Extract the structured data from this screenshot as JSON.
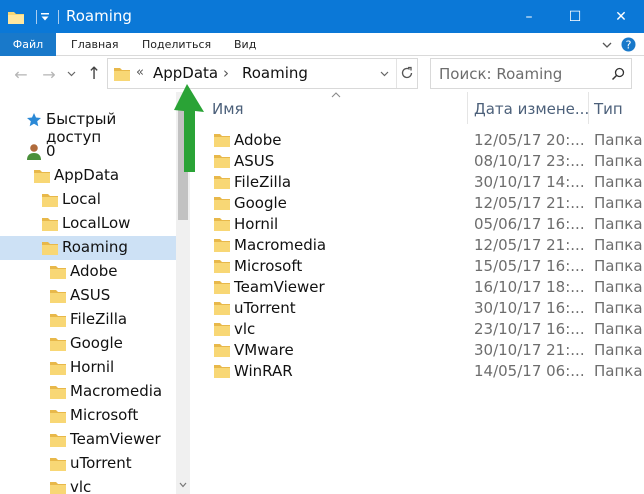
{
  "window": {
    "title": "Roaming",
    "accent": "#0b78d7",
    "minimize_glyph": "–",
    "maximize_glyph": "☐",
    "close_glyph": "✕"
  },
  "ribbon": {
    "tabs": [
      "Файл",
      "Главная",
      "Поделиться",
      "Вид"
    ]
  },
  "navigation": {
    "back_glyph": "←",
    "forward_glyph": "→",
    "up_glyph": "↑",
    "address": {
      "overflow": "«",
      "crumbs": [
        "AppData",
        "Roaming"
      ],
      "separator": "›"
    },
    "search_placeholder": "Поиск: Roaming"
  },
  "nav_pane": {
    "quick_access": "Быстрый доступ",
    "user": "0",
    "items": [
      {
        "label": "AppData"
      },
      {
        "label": "Local"
      },
      {
        "label": "LocalLow"
      },
      {
        "label": "Roaming",
        "selected": true
      },
      {
        "label": "Adobe"
      },
      {
        "label": "ASUS"
      },
      {
        "label": "FileZilla"
      },
      {
        "label": "Google"
      },
      {
        "label": "Hornil"
      },
      {
        "label": "Macromedia"
      },
      {
        "label": "Microsoft"
      },
      {
        "label": "TeamViewer"
      },
      {
        "label": "uTorrent"
      },
      {
        "label": "vlc"
      }
    ]
  },
  "columns": {
    "name": "Имя",
    "date": "Дата измене...",
    "type": "Тип"
  },
  "files": [
    {
      "name": "Adobe",
      "date": "12/05/17 20:...",
      "type": "Папка"
    },
    {
      "name": "ASUS",
      "date": "08/10/17 23:...",
      "type": "Папка"
    },
    {
      "name": "FileZilla",
      "date": "30/10/17 14:...",
      "type": "Папка"
    },
    {
      "name": "Google",
      "date": "12/05/17 21:...",
      "type": "Папка"
    },
    {
      "name": "Hornil",
      "date": "05/06/17 16:...",
      "type": "Папка"
    },
    {
      "name": "Macromedia",
      "date": "12/05/17 21:...",
      "type": "Папка"
    },
    {
      "name": "Microsoft",
      "date": "15/05/17 16:...",
      "type": "Папка"
    },
    {
      "name": "TeamViewer",
      "date": "16/10/17 18:...",
      "type": "Папка"
    },
    {
      "name": "uTorrent",
      "date": "30/10/17 16:...",
      "type": "Папка"
    },
    {
      "name": "vlc",
      "date": "23/10/17 16:...",
      "type": "Папка"
    },
    {
      "name": "VMware",
      "date": "30/10/17 21:...",
      "type": "Папка"
    },
    {
      "name": "WinRAR",
      "date": "14/05/17 06:...",
      "type": "Папка"
    }
  ],
  "annotation_color": "#2aa336",
  "folder_color": "#f8d775"
}
